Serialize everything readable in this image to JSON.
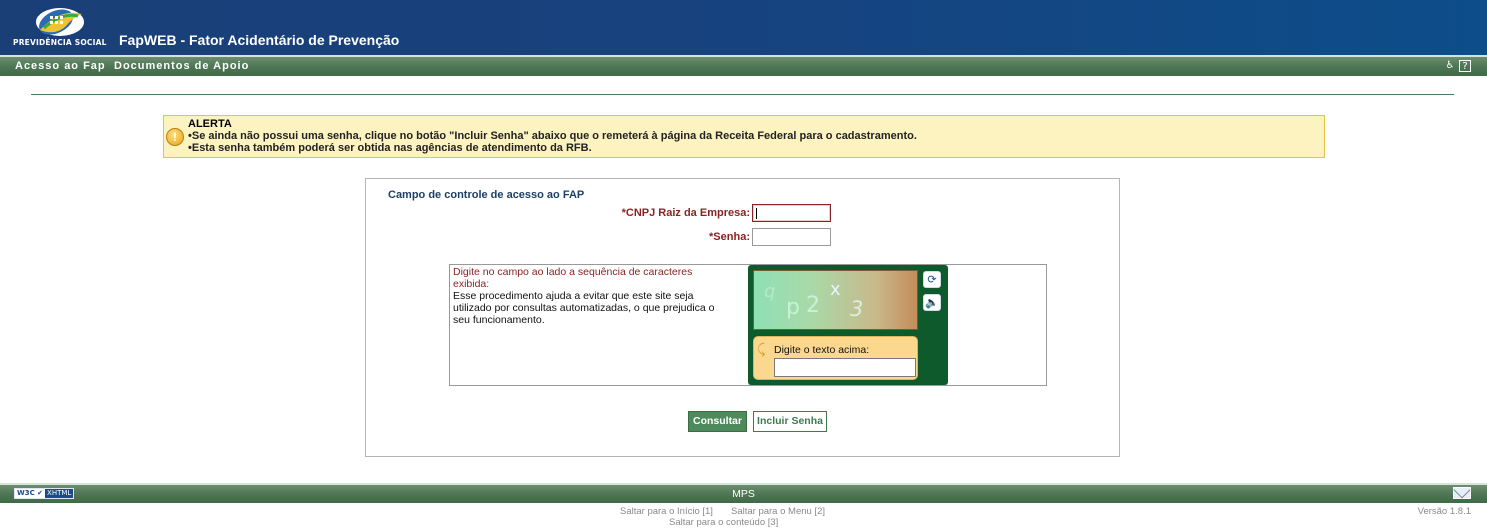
{
  "header": {
    "logo_text": "PREVIDÊNCIA SOCIAL",
    "app_title": "FapWEB - Fator Acidentário de Prevenção"
  },
  "menu": {
    "items": [
      "Acesso ao Fap",
      "Documentos de Apoio"
    ],
    "accessibility_icon": "wheelchair-icon",
    "help_icon": "help-icon",
    "help_glyph": "?"
  },
  "alert": {
    "title": "ALERTA",
    "icon": "!",
    "lines": [
      "•Se ainda não possui uma senha, clique no botão \"Incluir Senha\" abaixo que o remeterá à página da Receita Federal para o cadastramento.",
      "•Esta senha também poderá ser obtida nas agências de atendimento da RFB."
    ]
  },
  "access": {
    "title": "Campo de controle de acesso ao FAP",
    "cnpj_label": "*CNPJ Raiz da Empresa:",
    "cnpj_value": "",
    "senha_label": "*Senha:",
    "senha_value": ""
  },
  "captcha": {
    "instruction": "Digite no campo ao lado a sequência de caracteres exibida:",
    "help": "Esse procedimento ajuda a evitar que este site seja utilizado por consultas automatizadas, o que prejudica o seu funcionamento.",
    "chars": [
      "q",
      "p",
      "2",
      "x",
      "3"
    ],
    "entry_label": "Digite o texto acima:",
    "entry_value": "",
    "refresh_glyph": "⟳",
    "audio_glyph": "🔈"
  },
  "buttons": {
    "consultar": "Consultar",
    "incluir_senha": "Incluir Senha"
  },
  "footer": {
    "w3c": "W3C ✔",
    "xhtml": "XHTML",
    "center": "MPS",
    "skip_inicio": "Saltar para o Início [1]",
    "skip_menu": "Saltar para o Menu [2]",
    "skip_conteudo": "Saltar para o conteúdo [3]",
    "version": "Versão 1.8.1"
  },
  "colors": {
    "header_blue": "#17427e",
    "menu_green": "#4f7655",
    "alert_bg": "#fdf3c1",
    "label_red": "#8a2323",
    "button_green": "#4f8a5c"
  }
}
